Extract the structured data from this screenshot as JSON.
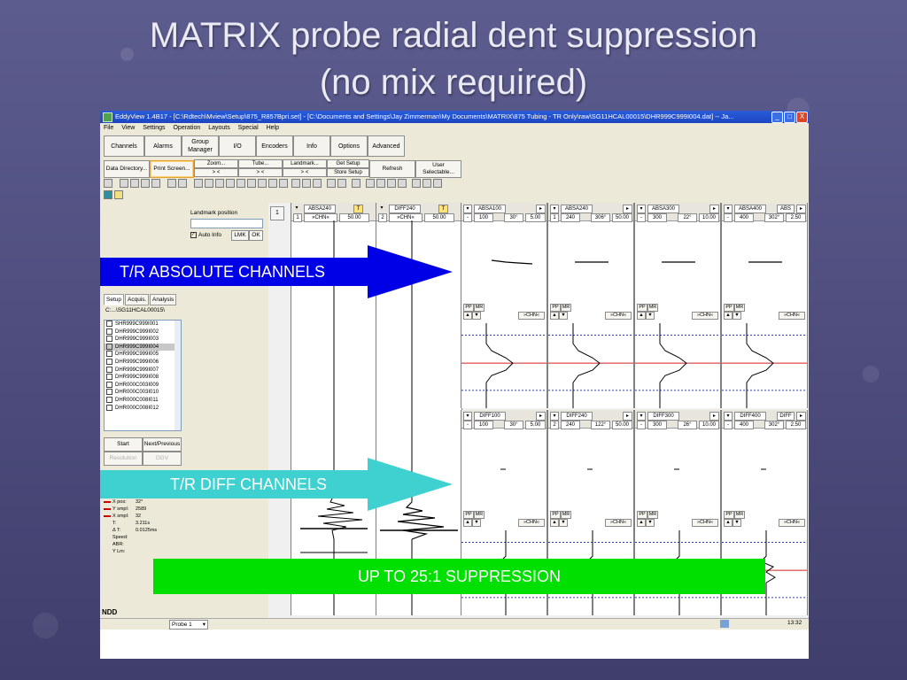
{
  "slide": {
    "title_line1": "MATRIX probe radial dent suppression",
    "title_line2": "(no mix required)"
  },
  "window": {
    "title": "EddyView 1.4B17 - [C:\\Rdtech\\Mview\\Setup\\875_R857Bpri.set] - [C:\\Documents and Settings\\Jay Zimmerman\\My Documents\\MATRIX\\875 Tubing - TR Only\\raw\\SG11HCAL00015\\DHR999C999I004.dat] -- Ja...",
    "menu": [
      "File",
      "View",
      "Settings",
      "Operation",
      "Layouts",
      "Special",
      "Help"
    ],
    "tabs": [
      "Channels",
      "Alarms",
      "Group Manager",
      "I/O",
      "Encoders",
      "Info",
      "Options",
      "Advanced"
    ],
    "row2": {
      "data_directory": "Data Directory...",
      "print_screen": "Print Screen...",
      "zoom": "Zoom...",
      "tube": "Tube...",
      "landmark": "Landmark...",
      "get_setup": "Get Setup",
      "store_setup": "Store Setup",
      "refresh": "Refresh",
      "user_selectable": "User Selectable...",
      "arrows": "> <"
    },
    "controls": {
      "minimize": "_",
      "maximize": "□",
      "close": "X"
    }
  },
  "left": {
    "landmark_label": "Landmark position",
    "auto_info": "Auto Info",
    "lmk": "LMK",
    "ok": "OK",
    "tabs": [
      "Setup",
      "Acquis.",
      "Analysis"
    ],
    "path": "C:...\\SG11HCAL00015\\",
    "files": [
      "SHR999C999I001",
      "DHR999C999I002",
      "DHR999C999I003",
      "DHR999C999I004",
      "DHR999C999I005",
      "DHR999C999I006",
      "DHR999C999I007",
      "DHR999C999I008",
      "DHR000C003I009",
      "DHR000C003I010",
      "DHR000C008I011",
      "DHR000C008I012"
    ],
    "selected_file_index": 3,
    "start": "Start",
    "next_previous": "Next/Previous",
    "resolution": "Resolution",
    "dgv": "DGV",
    "info": [
      {
        "k": "X pos:",
        "v": "32°",
        "marker": true
      },
      {
        "k": "Y smpl:",
        "v": "2589",
        "marker": true
      },
      {
        "k": "X smpl:",
        "v": "32",
        "marker": true
      },
      {
        "k": "T:",
        "v": "3.211s",
        "marker": false
      },
      {
        "k": "Δ T:",
        "v": "0.0125ms",
        "marker": false
      },
      {
        "k": "Speed:",
        "v": "",
        "marker": false
      },
      {
        "k": "ABR:",
        "v": "",
        "marker": false
      },
      {
        "k": "Y Lm:",
        "v": "",
        "marker": false
      }
    ],
    "ndd": "NDD"
  },
  "strips": [
    {
      "num": "1",
      "name": "ABSA240",
      "chn": "»CHN«",
      "idx": "1",
      "val": "50.00"
    },
    {
      "num": "",
      "name": "DIFF240",
      "chn": "»CHN«",
      "idx": "2",
      "val": "50.00"
    }
  ],
  "abs_panels": [
    {
      "name": "ABSA100",
      "idx": "-",
      "freq": "100",
      "angle": "30°",
      "span": "5.00"
    },
    {
      "name": "ABSA240",
      "idx": "1",
      "freq": "240",
      "angle": "306°",
      "span": "50.00"
    },
    {
      "name": "ABSA300",
      "idx": "-",
      "freq": "300",
      "angle": "22°",
      "span": "10.00"
    },
    {
      "name": "ABSA400",
      "idx": "-",
      "freq": "400",
      "angle": "302°",
      "span": "2.50",
      "tag": "ABS"
    }
  ],
  "diff_panels": [
    {
      "name": "DIFF100",
      "idx": "-",
      "freq": "100",
      "angle": "30°",
      "span": "5.00"
    },
    {
      "name": "DIFF240",
      "idx": "2",
      "freq": "240",
      "angle": "122°",
      "span": "50.00"
    },
    {
      "name": "DIFF300",
      "idx": "-",
      "freq": "300",
      "angle": "26°",
      "span": "10.00"
    },
    {
      "name": "DIFF400",
      "idx": "-",
      "freq": "400",
      "angle": "302°",
      "span": "2.50",
      "tag": "DIFF"
    }
  ],
  "panel_controls": {
    "pp": "PP",
    "mr": "MR",
    "up": "▲",
    "down": "▼",
    "chn": "»CHN«"
  },
  "statusbar": {
    "probe": "Probe 1",
    "time": "13:32"
  },
  "callouts": {
    "absolute": "T/R ABSOLUTE CHANNELS",
    "diff": "T/R DIFF CHANNELS",
    "suppression": "UP TO 25:1 SUPPRESSION"
  },
  "colors": {
    "abs_arrow": "#0000e6",
    "diff_arrow": "#3fd0d0",
    "suppression_box": "#00e000",
    "title_bar": "#2b5bd7",
    "trace_red": "#d02020",
    "trace_blue": "#2a3fc8"
  }
}
